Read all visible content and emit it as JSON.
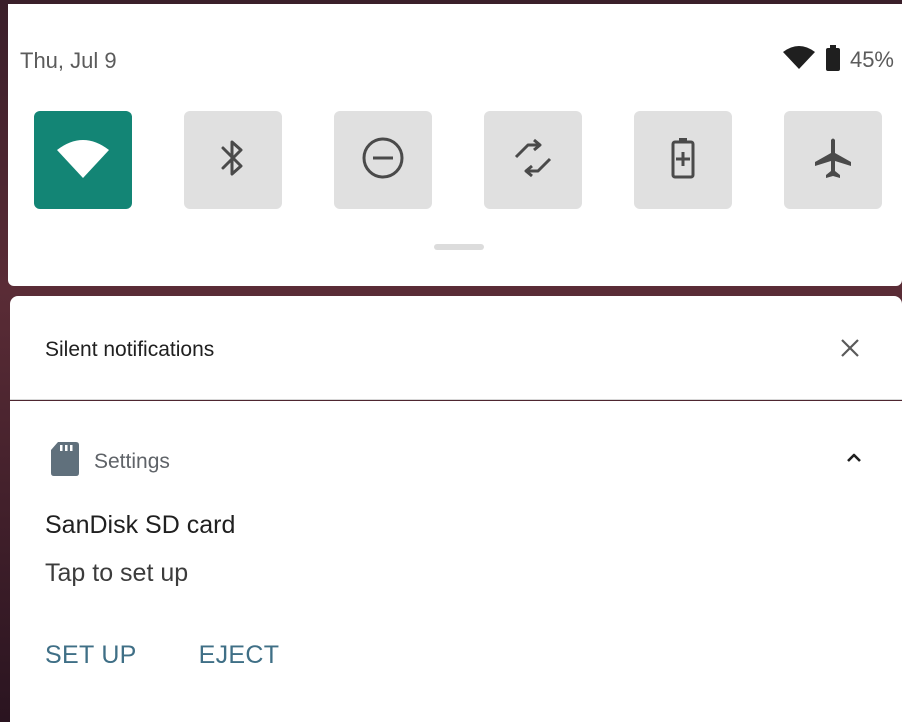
{
  "status_bar": {
    "date": "Thu, Jul 9",
    "battery_percent": "45%",
    "icons": [
      "wifi-signal-icon",
      "battery-icon"
    ]
  },
  "quick_settings": {
    "accent_color": "#138575",
    "tiles": [
      {
        "icon": "wifi-icon",
        "active": true
      },
      {
        "icon": "bluetooth-icon",
        "active": false
      },
      {
        "icon": "do-not-disturb-icon",
        "active": false
      },
      {
        "icon": "auto-rotate-icon",
        "active": false
      },
      {
        "icon": "battery-saver-icon",
        "active": false
      },
      {
        "icon": "airplane-mode-icon",
        "active": false
      }
    ]
  },
  "silent_section": {
    "title": "Silent notifications",
    "close_icon": "close-icon"
  },
  "notification": {
    "app_icon": "sd-card-icon",
    "app_name": "Settings",
    "expand_icon": "chevron-up-icon",
    "title": "SanDisk SD card",
    "body": "Tap to set up",
    "actions": [
      {
        "label": "SET UP"
      },
      {
        "label": "EJECT"
      }
    ],
    "action_color": "#3f6f86"
  }
}
